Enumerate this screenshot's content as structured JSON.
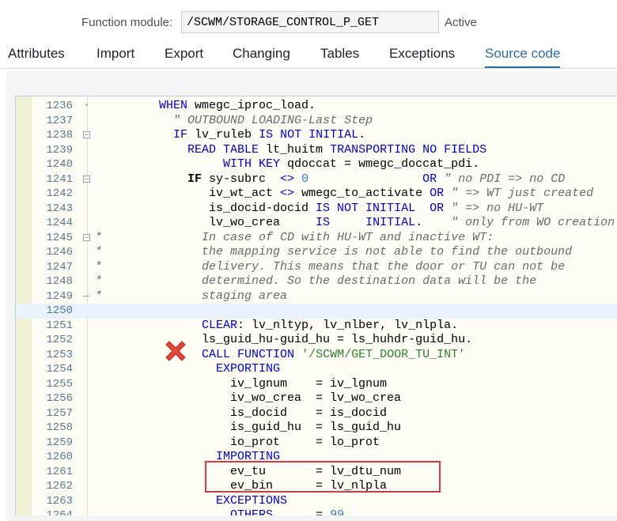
{
  "header": {
    "function_module_label": "Function module:",
    "function_module_value": "/SCWM/STORAGE_CONTROL_P_GET",
    "status": "Active"
  },
  "tabs": [
    {
      "label": "Attributes"
    },
    {
      "label": "Import"
    },
    {
      "label": "Export"
    },
    {
      "label": "Changing"
    },
    {
      "label": "Tables"
    },
    {
      "label": "Exceptions"
    },
    {
      "label": "Source code",
      "active": true
    }
  ],
  "lines": [
    {
      "no": "1236",
      "fold": "dot",
      "html": "         <span class=\"kw\">WHEN</span> wmegc_iproc_load."
    },
    {
      "no": "1237",
      "fold": "",
      "html": "           <span class=\"cm\">\" OUTBOUND LOADING-Last Step</span>"
    },
    {
      "no": "1238",
      "fold": "box",
      "html": "           <span class=\"kw\">IF</span> lv_ruleb <span class=\"kw\">IS NOT INITIAL</span>."
    },
    {
      "no": "1239",
      "fold": "",
      "html": "             <span class=\"kw\">READ TABLE</span> lt_huitm <span class=\"kw\">TRANSPORTING NO FIELDS</span>"
    },
    {
      "no": "1240",
      "fold": "",
      "html": "                  <span class=\"kw\">WITH KEY</span> qdoccat = wmegc_doccat_pdi."
    },
    {
      "no": "1241",
      "fold": "box",
      "html": "             <span class=\"bold\">IF</span> sy-subrc  <span class=\"kw\">&lt;&gt;</span> <span class=\"num\">0</span>                <span class=\"kw\">OR</span> <span class=\"cm\">\" no PDI =&gt; no CD</span>"
    },
    {
      "no": "1242",
      "fold": "",
      "html": "                iv_wt_act <span class=\"kw\">&lt;&gt;</span> wmegc_to_activate <span class=\"kw\">OR</span> <span class=\"cm\">\" =&gt; WT just created</span>"
    },
    {
      "no": "1243",
      "fold": "",
      "html": "                is_docid-docid <span class=\"kw\">IS NOT INITIAL</span>  <span class=\"kw\">OR</span> <span class=\"cm\">\" =&gt; no HU-WT</span>"
    },
    {
      "no": "1244",
      "fold": "",
      "html": "                lv_wo_crea     <span class=\"kw\">IS</span>     <span class=\"kw\">INITIAL</span>.    <span class=\"cm\">\" only from WO creation</span>"
    },
    {
      "no": "1245",
      "fold": "box",
      "html": "<span class=\"cm\">*              In case of CD with HU-WT and inactive WT:</span>"
    },
    {
      "no": "1246",
      "fold": "",
      "html": "<span class=\"cm\">*              the mapping service is not able to find the outbound</span>"
    },
    {
      "no": "1247",
      "fold": "",
      "html": "<span class=\"cm\">*              delivery. This means that the door or TU can not be</span>"
    },
    {
      "no": "1248",
      "fold": "",
      "html": "<span class=\"cm\">*              determined. So the destination data will be the</span>"
    },
    {
      "no": "1249",
      "fold": "end",
      "html": "<span class=\"cm\">*              staging area</span>"
    },
    {
      "no": "1250",
      "fold": "",
      "hl": true,
      "html": ""
    },
    {
      "no": "1251",
      "fold": "",
      "html": "               <span class=\"kw\">CLEAR</span>: lv_nltyp, lv_nlber, lv_nlpla."
    },
    {
      "no": "1252",
      "fold": "",
      "html": "               ls_guid_hu-guid_hu = ls_huhdr-guid_hu."
    },
    {
      "no": "1253",
      "fold": "",
      "html": "               <span class=\"kw\">CALL FUNCTION</span> <span class=\"str\">'/SCWM/GET_DOOR_TU_INT'</span>"
    },
    {
      "no": "1254",
      "fold": "",
      "html": "                 <span class=\"kw\">EXPORTING</span>"
    },
    {
      "no": "1255",
      "fold": "",
      "html": "                   iv_lgnum    = iv_lgnum"
    },
    {
      "no": "1256",
      "fold": "",
      "html": "                   iv_wo_crea  = lv_wo_crea"
    },
    {
      "no": "1257",
      "fold": "",
      "html": "                   is_docid    = is_docid"
    },
    {
      "no": "1258",
      "fold": "",
      "html": "                   is_guid_hu  = ls_guid_hu"
    },
    {
      "no": "1259",
      "fold": "",
      "html": "                   io_prot     = lo_prot"
    },
    {
      "no": "1260",
      "fold": "",
      "html": "                 <span class=\"kw\">IMPORTING</span>"
    },
    {
      "no": "1261",
      "fold": "",
      "html": "                   ev_tu       = lv_dtu_num"
    },
    {
      "no": "1262",
      "fold": "",
      "html": "                   ev_bin      = lv_nlpla"
    },
    {
      "no": "1263",
      "fold": "",
      "html": "                 <span class=\"kw\">EXCEPTIONS</span>"
    },
    {
      "no": "1264",
      "fold": "",
      "html": "                   <span class=\"kw\">OTHERS</span>      = <span class=\"num\">99</span>"
    }
  ],
  "colors": {
    "keyword": "#0000c8",
    "comment": "#6a6a6a",
    "string": "#308030",
    "active_tab": "#2f6ea5",
    "highlight_box": "#e0383a"
  }
}
